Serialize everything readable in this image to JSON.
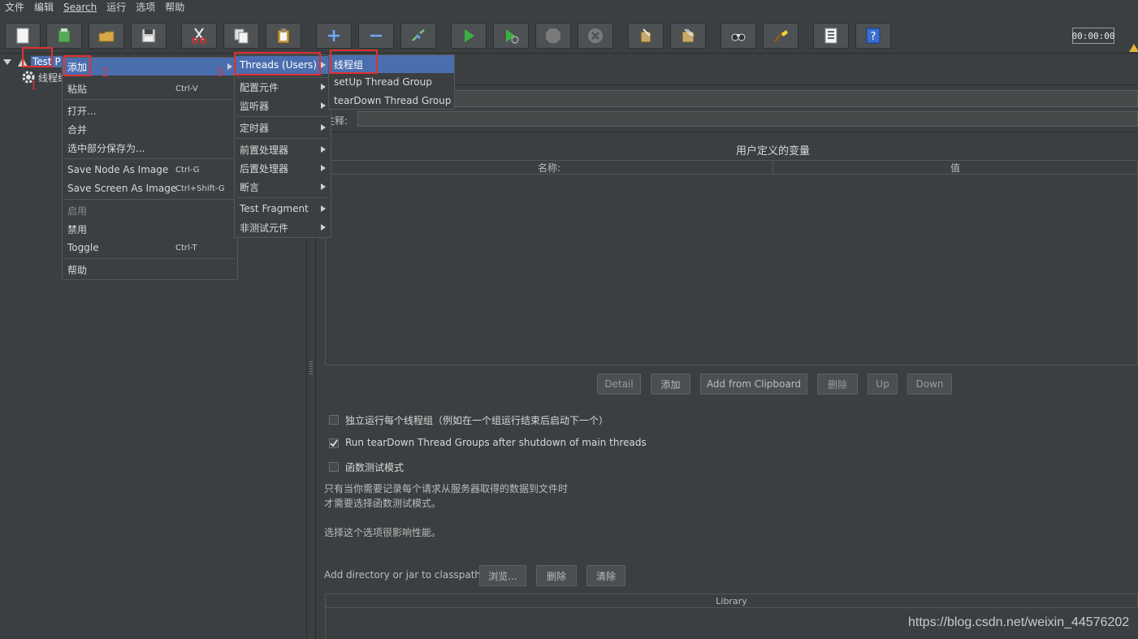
{
  "menubar": [
    "文件",
    "编辑",
    "Search",
    "运行",
    "选项",
    "帮助"
  ],
  "toolbar": {
    "icons": [
      "new-icon",
      "templates-icon",
      "open-icon",
      "save-icon",
      "cut-icon",
      "copy-icon",
      "paste-icon",
      "expand-icon",
      "collapse-icon",
      "toggle-icon",
      "start-icon",
      "start-no-pause-icon",
      "stop-icon",
      "shutdown-icon",
      "clear-icon",
      "clear-all-icon",
      "search-icon",
      "reset-search-icon",
      "function-helper-icon",
      "help-icon"
    ],
    "timer": "00:00:00"
  },
  "tree": {
    "root_label": "Test P",
    "child_label": "线程组"
  },
  "context_menu": {
    "items": [
      {
        "label": "添加",
        "shortcut": ""
      },
      {
        "label": "粘贴",
        "shortcut": "Ctrl-V"
      },
      {
        "label": "打开...",
        "shortcut": ""
      },
      {
        "label": "合并",
        "shortcut": ""
      },
      {
        "label": "选中部分保存为...",
        "shortcut": ""
      },
      {
        "label": "Save Node As Image",
        "shortcut": "Ctrl-G"
      },
      {
        "label": "Save Screen As Image",
        "shortcut": "Ctrl+Shift-G"
      },
      {
        "label": "启用",
        "shortcut": ""
      },
      {
        "label": "禁用",
        "shortcut": ""
      },
      {
        "label": "Toggle",
        "shortcut": "Ctrl-T"
      },
      {
        "label": "帮助",
        "shortcut": ""
      }
    ]
  },
  "add_submenu": {
    "items": [
      "Threads (Users)",
      "配置元件",
      "监听器",
      "定时器",
      "前置处理器",
      "后置处理器",
      "断言",
      "Test Fragment",
      "非测试元件"
    ]
  },
  "threads_submenu": {
    "items": [
      "线程组",
      "setUp Thread Group",
      "tearDown Thread Group"
    ]
  },
  "annotations": [
    "1",
    "2",
    "3"
  ],
  "panel": {
    "comment_label": "注释:",
    "vars_title": "用户定义的变量",
    "col_name": "名称:",
    "col_value": "值",
    "buttons": [
      "Detail",
      "添加",
      "Add from Clipboard",
      "删除",
      "Up",
      "Down"
    ],
    "opt_serial": "独立运行每个线程组（例如在一个组运行结束后启动下一个）",
    "opt_teardown": "Run tearDown Thread Groups after shutdown of main threads",
    "opt_functional": "函数测试模式",
    "opt_serial_checked": false,
    "opt_teardown_checked": true,
    "opt_functional_checked": false,
    "note1": "只有当你需要记录每个请求从服务器取得的数据到文件时",
    "note2": "才需要选择函数测试模式。",
    "note3": "选择这个选项很影响性能。",
    "classpath_label": "Add directory or jar to classpath",
    "classpath_buttons": [
      "浏览...",
      "删除",
      "清除"
    ],
    "library_header": "Library"
  },
  "watermark": "https://blog.csdn.net/weixin_44576202",
  "colors": {
    "background": "#3c3f41",
    "selection": "#4b6eaf",
    "annotation": "#e03030"
  }
}
